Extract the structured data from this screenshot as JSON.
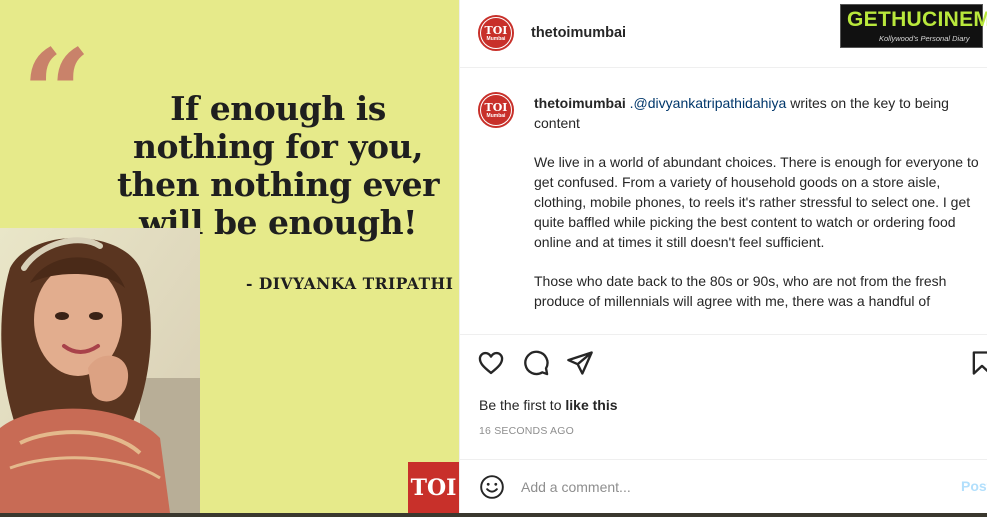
{
  "image": {
    "quote_mark": "“",
    "quote": "If enough is nothing for you, then nothing ever will be enough!",
    "author": "- DIVYANKA TRIPATHI",
    "publisher_logo": "TOI",
    "background_color": "#e6ea8a"
  },
  "header": {
    "avatar_text": "TOI",
    "avatar_subtext": "Mumbai",
    "username": "thetoimumbai"
  },
  "watermark": {
    "title": "GETHUCINEMA",
    "tagline": "Kollywood's Personal Diary"
  },
  "caption": {
    "username": "thetoimumbai",
    "mention": ".@divyankatripathidahiya",
    "lead": " writes on the key to being content",
    "paragraph_1": "We live in a world of abundant choices. There is enough for everyone to get confused. From a variety of household goods on a store aisle, clothing, mobile phones, to reels it's rather stressful to select one. I get quite baffled while picking the best content to watch or ordering food online and at times it still doesn't feel sufficient.",
    "paragraph_2": "Those who date back to the 80s or 90s, who are not from the fresh produce of millennials will agree with me, there was a handful of"
  },
  "actions": {
    "like_icon": "heart-icon",
    "comment_icon": "comment-icon",
    "share_icon": "paper-plane-icon",
    "save_icon": "bookmark-icon"
  },
  "likes": {
    "prefix": "Be the first to ",
    "link": "like this"
  },
  "timestamp": "16 SECONDS AGO",
  "comment": {
    "placeholder": "Add a comment...",
    "post_label": "Post",
    "emoji_icon": "smiley-icon"
  },
  "colors": {
    "brand_red": "#c8302a",
    "mention_blue": "#00376b",
    "post_disabled": "#b2dffc",
    "quote_accent": "#c9826a"
  }
}
